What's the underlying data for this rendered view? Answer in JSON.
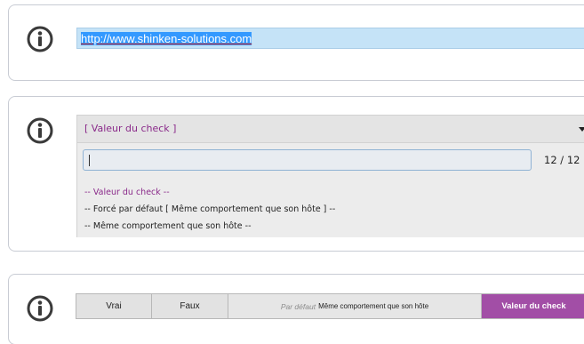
{
  "url_panel": {
    "url_value": "http://www.shinken-solutions.com"
  },
  "select_panel": {
    "selected_label": "[ Valeur du check ]",
    "search_value": "",
    "search_count": "12 / 12",
    "options": [
      {
        "label": "-- Valeur du check --",
        "current": true
      },
      {
        "label": "-- Forcé par défaut [ Même comportement que son hôte ] --",
        "current": false
      },
      {
        "label": "-- Même comportement que son hôte --",
        "current": false
      }
    ]
  },
  "segment_panel": {
    "vrai_label": "Vrai",
    "faux_label": "Faux",
    "default_prefix": "Par défaut",
    "default_value": "Même comportement que son hôte",
    "check_label": "Valeur du check",
    "active_segment": "Valeur du check"
  },
  "icons": {
    "info": "info-circle-icon",
    "dropdown": "caret-down-icon"
  },
  "colors": {
    "accent_purple": "#a24ea6",
    "url_highlight": "#3399ff",
    "field_blue": "#c5e3f7",
    "text_purple": "#8a2a8a"
  }
}
